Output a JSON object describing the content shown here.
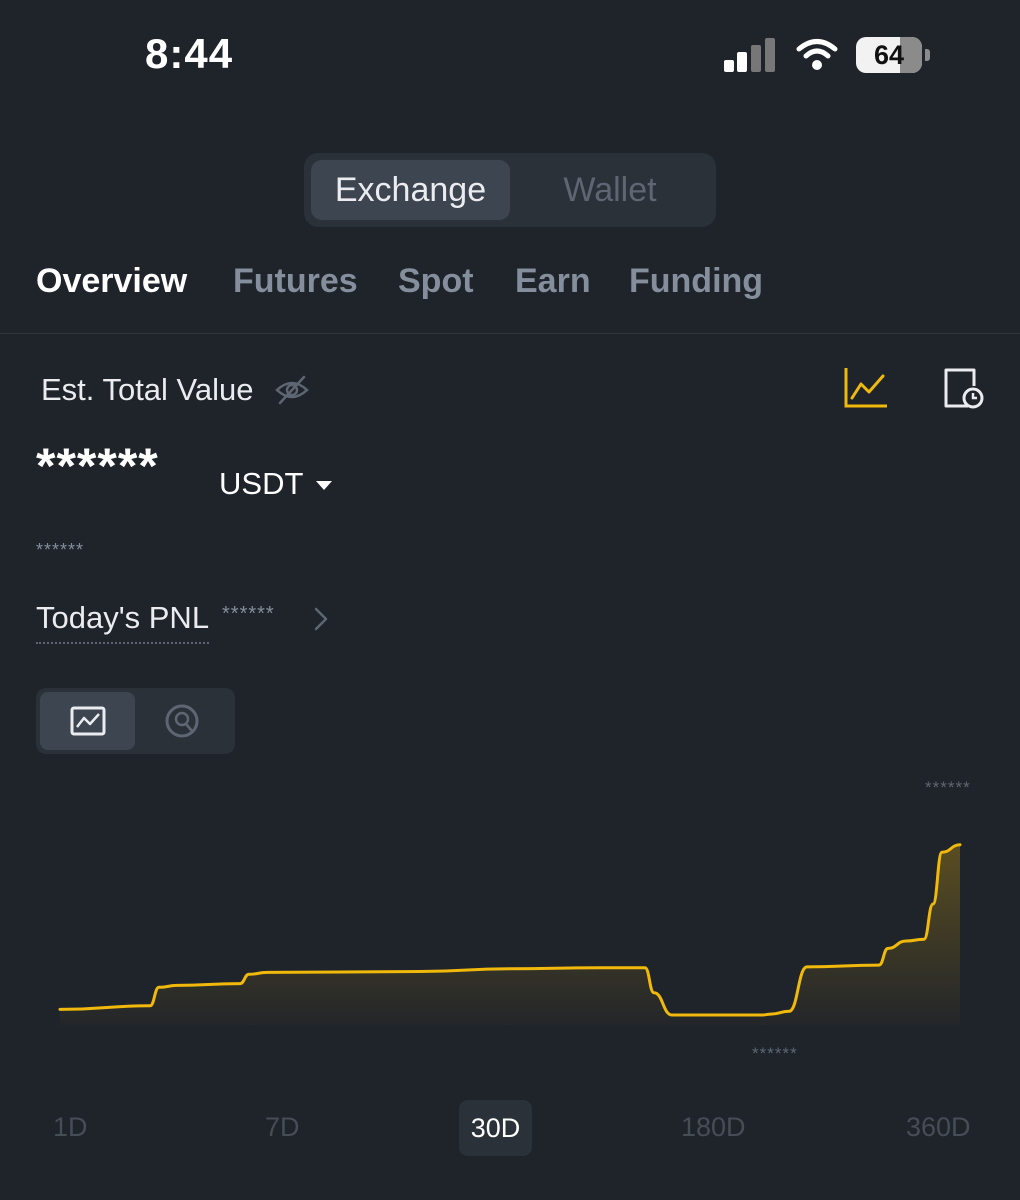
{
  "status_bar": {
    "time": "8:44",
    "battery": "64"
  },
  "segment": {
    "exchange": "Exchange",
    "wallet": "Wallet",
    "selected": "Exchange"
  },
  "tabs": [
    {
      "label": "Overview",
      "active": true
    },
    {
      "label": "Futures",
      "active": false
    },
    {
      "label": "Spot",
      "active": false
    },
    {
      "label": "Earn",
      "active": false
    },
    {
      "label": "Funding",
      "active": false
    }
  ],
  "overview": {
    "est_label": "Est. Total Value",
    "total_value": "******",
    "currency": "USDT",
    "secondary_value": "******",
    "pnl_label": "Today's PNL",
    "pnl_value": "******"
  },
  "chart": {
    "max_label": "******",
    "min_label": "******",
    "line_color": "#f0b90b"
  },
  "chart_data": {
    "type": "area",
    "title": "",
    "xlabel": "",
    "ylabel": "",
    "ylim": [
      0,
      100
    ],
    "grid": false,
    "x": [
      0,
      10,
      11,
      13,
      20,
      21,
      23,
      40,
      50,
      60,
      65,
      66,
      68,
      78,
      79,
      81,
      83,
      91,
      92,
      94,
      96,
      97,
      98,
      100
    ],
    "series": [
      {
        "values": [
          3,
          5,
          15,
          16,
          17,
          22,
          23,
          23.5,
          25,
          25.5,
          25.5,
          12,
          0,
          0,
          0.5,
          2,
          26,
          27,
          36,
          40,
          41,
          60,
          88,
          92
        ]
      }
    ]
  },
  "periods": [
    "1D",
    "7D",
    "30D",
    "180D",
    "360D"
  ],
  "selected_period": "30D"
}
